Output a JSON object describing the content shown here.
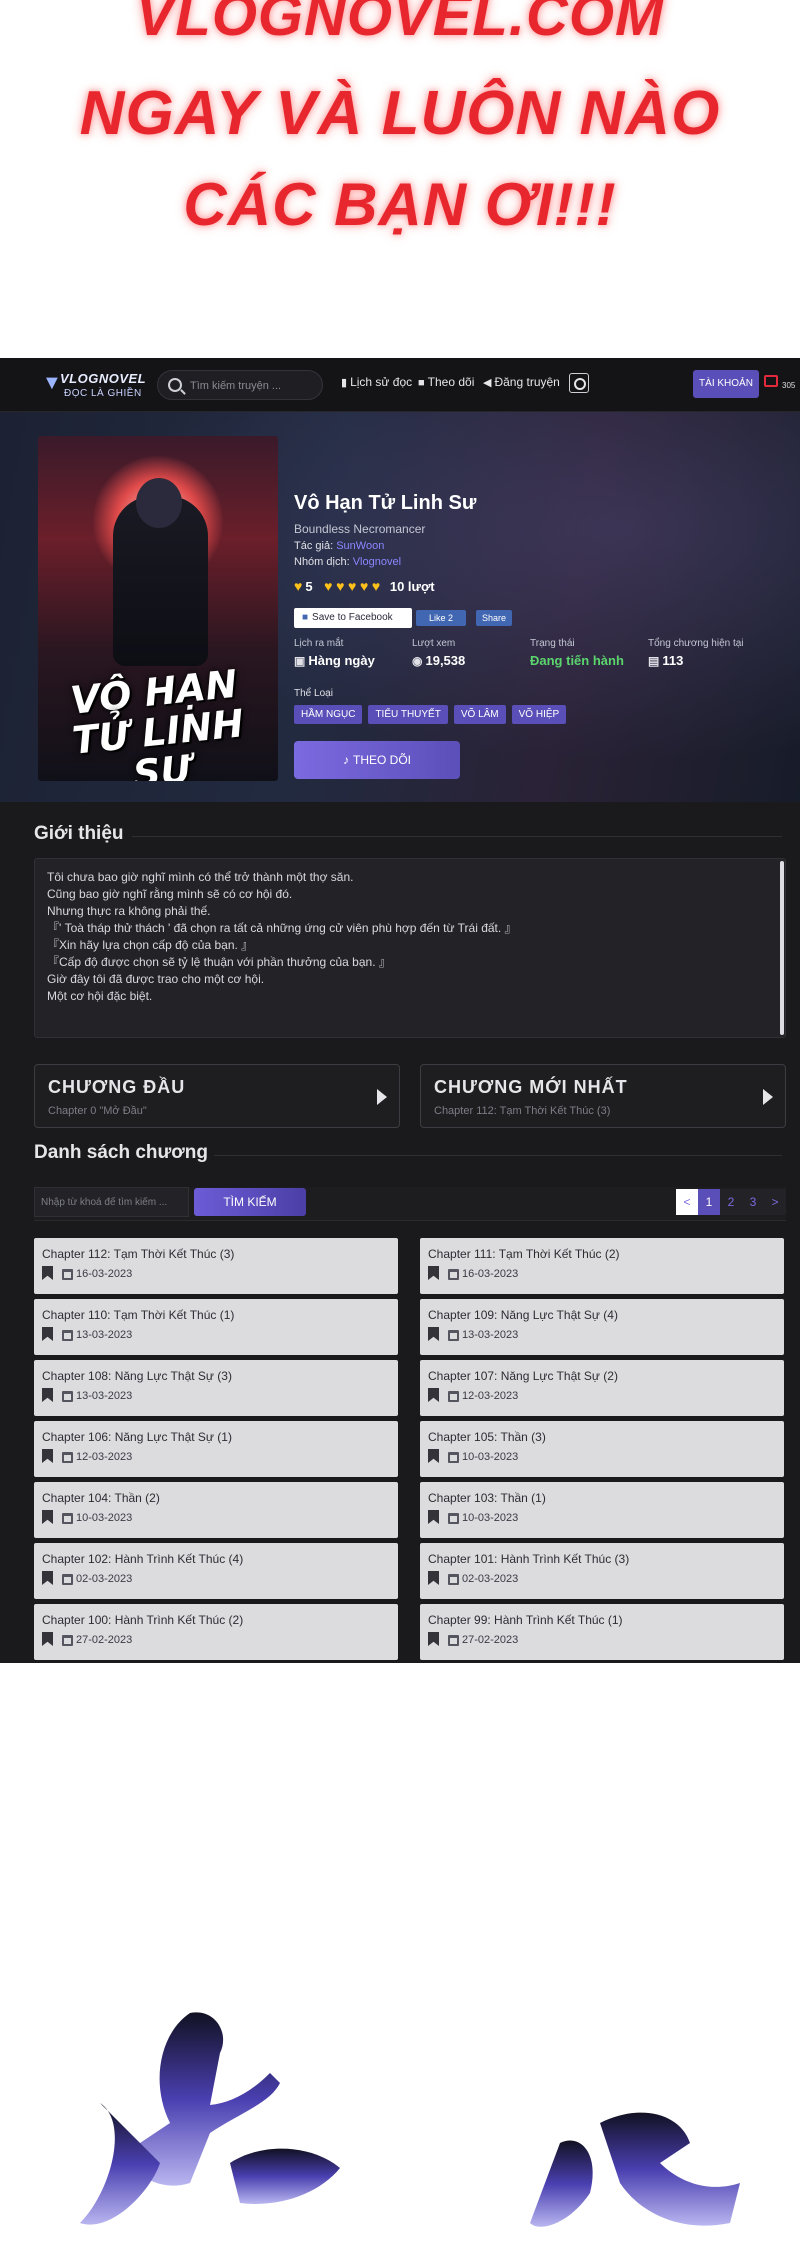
{
  "banner": {
    "line1": "VLOGNOVEL.COM",
    "line2": "NGAY VÀ LUÔN NÀO",
    "line3": "CÁC BẠN ƠI!!!"
  },
  "topbar": {
    "logo_text": "VLOGNOVEL",
    "logo_sub": "ĐỌC LÀ GHIỀN",
    "search_placeholder": "Tìm kiếm truyện ...",
    "nav": [
      {
        "label": "Lịch sử đọc",
        "icon": "book-icon"
      },
      {
        "label": "Theo dõi",
        "icon": "bookmark-icon"
      },
      {
        "label": "Đăng truyện",
        "icon": "megaphone-icon"
      }
    ],
    "account_label": "TÀI KHOẢN",
    "notification_count": "305"
  },
  "cover": {
    "title_line1": "VÔ HẠN",
    "title_line2": "TỬ LINH SƯ"
  },
  "novel": {
    "title": "Vô Hạn Tử Linh Sư",
    "alt_title": "Boundless Necromancer",
    "author_label": "Tác giả:",
    "author": "SunWoon",
    "team_label": "Nhóm dịch:",
    "team": "Vlognovel",
    "rating_score": "5",
    "rating_hearts": 5,
    "rating_count": "10 lượt",
    "fb_save_label": "Save to Facebook",
    "fb_like_label": "Like 2",
    "fb_share_label": "Share",
    "stats": [
      {
        "label": "Lịch ra mắt",
        "value": "Hàng ngày",
        "icon": "calendar-icon"
      },
      {
        "label": "Lượt xem",
        "value": "19,538",
        "icon": "eye-icon"
      },
      {
        "label": "Trạng thái",
        "value": "Đang tiến hành",
        "icon": ""
      },
      {
        "label": "Tổng chương hiện tại",
        "value": "113",
        "icon": "list-icon"
      }
    ],
    "genre_label": "Thể Loại",
    "tags": [
      "HẦM NGỤC",
      "TIỂU THUYẾT",
      "VÕ LÂM",
      "VÕ HIỆP"
    ],
    "follow_label": "THEO DÕI",
    "status_color": "#5bd46d",
    "accent_color": "#5a4fb8"
  },
  "intro": {
    "heading": "Giới thiệu",
    "paragraphs": [
      "Tôi chưa bao giờ nghĩ mình có thể trở thành một thợ săn.",
      "Cũng bao giờ nghĩ rằng mình sẽ có cơ hội đó.",
      "Nhưng thực ra không phải thế.",
      "『' Toà tháp thử thách ' đã chọn ra tất cả những ứng cử viên phù hợp đến từ Trái đất. 』",
      "『Xin hãy lựa chọn cấp độ của bạn. 』",
      "『Cấp độ được chọn sẽ tỷ lệ thuận với phần thưởng của bạn. 』",
      "Giờ đây tôi đã được trao cho một cơ hội.",
      "Một cơ hội đặc biệt."
    ]
  },
  "chapter_buttons": {
    "first": {
      "title": "CHƯƠNG ĐẦU",
      "subtitle": "Chapter 0 \"Mở Đầu\""
    },
    "latest": {
      "title": "CHƯƠNG MỚI NHẤT",
      "subtitle": "Chapter 112: Tạm Thời Kết Thúc (3)"
    }
  },
  "chapter_list": {
    "heading": "Danh sách chương",
    "filter_placeholder": "Nhập từ khoá để tìm kiếm ...",
    "search_label": "TÌM KIẾM",
    "pagination": [
      "<",
      "1",
      "2",
      "3",
      ">"
    ],
    "active_page": "1",
    "chapters": [
      {
        "name": "Chapter 112: Tạm Thời Kết Thúc (3)",
        "date": "16-03-2023"
      },
      {
        "name": "Chapter 111: Tạm Thời Kết Thúc (2)",
        "date": "16-03-2023"
      },
      {
        "name": "Chapter 110: Tạm Thời Kết Thúc (1)",
        "date": "13-03-2023"
      },
      {
        "name": "Chapter 109: Năng Lực Thật Sự (4)",
        "date": "13-03-2023"
      },
      {
        "name": "Chapter 108: Năng Lực Thật Sự (3)",
        "date": "13-03-2023"
      },
      {
        "name": "Chapter 107: Năng Lực Thật Sự (2)",
        "date": "12-03-2023"
      },
      {
        "name": "Chapter 106: Năng Lực Thật Sự (1)",
        "date": "12-03-2023"
      },
      {
        "name": "Chapter 105: Thần (3)",
        "date": "10-03-2023"
      },
      {
        "name": "Chapter 104: Thần (2)",
        "date": "10-03-2023"
      },
      {
        "name": "Chapter 103: Thần (1)",
        "date": "10-03-2023"
      },
      {
        "name": "Chapter 102: Hành Trình Kết Thúc (4)",
        "date": "02-03-2023"
      },
      {
        "name": "Chapter 101: Hành Trình Kết Thúc (3)",
        "date": "02-03-2023"
      },
      {
        "name": "Chapter 100: Hành Trình Kết Thúc (2)",
        "date": "27-02-2023"
      },
      {
        "name": "Chapter 99: Hành Trình Kết Thúc (1)",
        "date": "27-02-2023"
      }
    ]
  }
}
